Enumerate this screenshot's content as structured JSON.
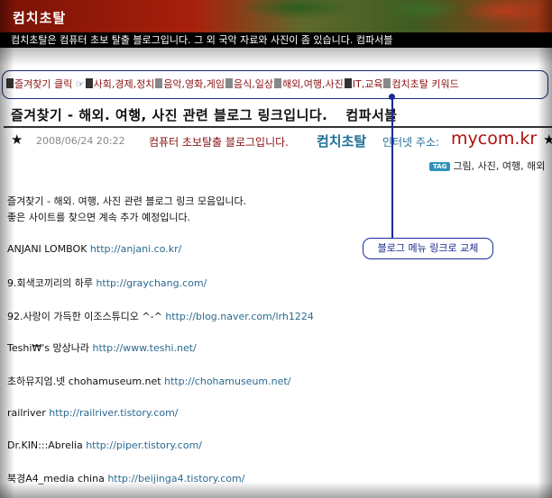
{
  "header": {
    "title": "컴치초탈",
    "subtitle": "컴치초탈은 컴퓨터 초보 탈출 블로그입니다. 그 외 국악 자료와 사진이 좀 있습니다. 컴파서블"
  },
  "nav": {
    "lead": "즐겨찾기 클릭",
    "flag_icon": "☞",
    "items": [
      "사회,경제,정치",
      "음악,영화,게임",
      "음식,일상",
      "해외,여행,사진",
      "IT,교육",
      "컴치초탈 키워드"
    ]
  },
  "post": {
    "title": "즐겨찾기 - 해외. 여행, 사진 관련 블로그 링크입니다.",
    "brand": "컴파서블",
    "star_icon": "★",
    "date": "2008/06/24 20:22",
    "blog_desc": "컴퓨터 초보탈출 블로그입니다.",
    "blog_name": "컴치초탈",
    "address_label": "인터넷 주소:",
    "domain": "mycom.kr",
    "tag_label": "TAG",
    "tags": "그림, 사진, 여행, 해외"
  },
  "content": {
    "intro": [
      "즐겨찾기 - 해외. 여행, 사진 관련 블로그 링크 모음입니다.",
      "좋은 사이트를 찾으면 계속 추가 예정입니다."
    ],
    "links": [
      {
        "name": "ANJANI LOMBOK",
        "url": "http://anjani.co.kr/"
      },
      {
        "name": "9.회색코끼리의 하루",
        "url": "http://graychang.com/"
      },
      {
        "name": "92.사랑이 가득한 이조스튜디오 ^-^",
        "url": "http://blog.naver.com/lrh1224"
      },
      {
        "name": "Teshi₩'s 망상나라",
        "url": "http://www.teshi.net/"
      },
      {
        "name": "초하뮤지엄.넷 chohamuseum.net",
        "url": "http://chohamuseum.net/"
      },
      {
        "name": "railriver",
        "url": "http://railriver.tistory.com/"
      },
      {
        "name": "Dr.KIN:::Abrelia",
        "url": "http://piper.tistory.com/"
      },
      {
        "name": "북경A4_media china",
        "url": "http://beijinga4.tistory.com/"
      }
    ]
  },
  "annotation": {
    "text": "블로그 메뉴 링크로 교체"
  },
  "colors": {
    "accent_red": "#8a1111",
    "link_blue": "#2a6a90",
    "annotation_blue": "#1a2a9a",
    "domain_red": "#b01010",
    "tag_badge": "#2f93b9"
  }
}
